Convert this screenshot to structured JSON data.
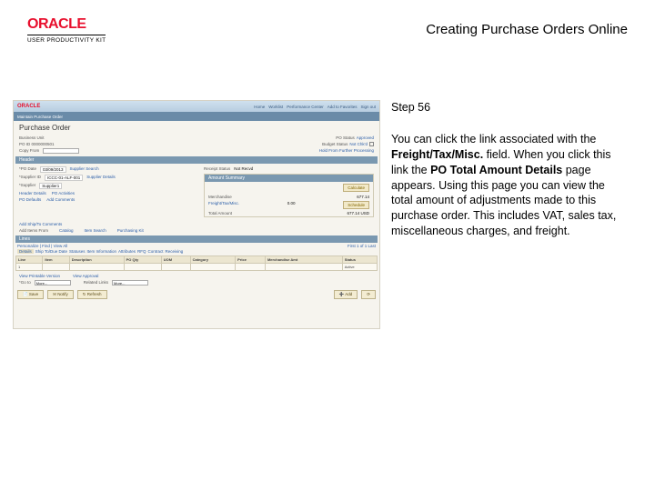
{
  "header": {
    "brand": "ORACLE",
    "brand_sub": "USER PRODUCTIVITY KIT",
    "title": "Creating Purchase Orders Online"
  },
  "step": {
    "label": "Step 56",
    "text_parts": {
      "p1": "You can click the link associated with the ",
      "bold1": "Freight/Tax/Misc.",
      "p2": " field. When you click this link the ",
      "bold2": "PO Total Amount Details",
      "p3": " page appears. Using this page you can view the total amount of adjustments made to this purchase order. This includes VAT, sales tax, miscellaneous charges, and freight."
    }
  },
  "screenshot": {
    "oracle_small": "ORACLE",
    "nav": [
      "Home",
      "Worklist",
      "Performance Center",
      "Add to Favorites",
      "Sign out"
    ],
    "darkbar_text": "Maintain Purchase Order",
    "page_title": "Purchase Order",
    "sub1": "Business Unit",
    "sub2": "PO ID  0000000501",
    "row1": {
      "po_status_label": "PO Status",
      "po_status_val": "Approved",
      "budget_label": "Budget Status",
      "budget_val": "Not Chk'd"
    },
    "copy_from_label": "Copy From",
    "hold_link": "Hold From Further Processing",
    "po_date_label": "*PO Date",
    "po_date_val": "03/09/2013",
    "supplier_label": "Supplier Search",
    "supplier_id_label": "*Supplier ID",
    "supplier_id_val": "ICCC-01-ALF-001",
    "id_alt_label": "Supplier Details",
    "supplier_name_label": "*Supplier",
    "supplier_name_val": "Supplier1",
    "calc_btn": "Calculate",
    "receipt_label": "Receipt Status",
    "receipt_val": "Not Recvd",
    "header_details_label": "Header Details",
    "po_defaults_label": "PO Defaults",
    "po_activities_label": "PO Activities",
    "add_comments_label": "Add Comments",
    "amount_summary_hdr": "Amount Summary",
    "merch_label": "Merchandise",
    "merch_val": "677.14",
    "ftm_label": "Freight/Tax/Misc.",
    "ftm_val": "0.00",
    "total_label": "Total Amount",
    "total_val": "677.14  USD",
    "schedule_btn": "Schedule",
    "add_ship_label": "Add Ship/To Comments",
    "add_items_label": "Add Items From",
    "catalog_label": "Catalog",
    "item_search_label": "Purchasing Kit",
    "item_search_label2": "Item Search",
    "tabs": [
      "Details",
      "Ship To/Due Date",
      "Statuses",
      "Item Information",
      "Attributes",
      "RFQ",
      "Contract",
      "Receiving"
    ],
    "personalize_label": "Personalize | Find | View All",
    "first_last": "First 1 of 1 Last",
    "grid": {
      "headers": [
        "Line",
        "Item",
        "Description",
        "PO Qty",
        "UOM",
        "Category",
        "Price",
        "Merchandise Amt",
        "Status"
      ],
      "row": [
        "1",
        "",
        "",
        "",
        "",
        "",
        "",
        "",
        "Active"
      ]
    },
    "row2": {
      "view_printable": "View Printable Version",
      "approval": "View Approval"
    },
    "go_row": {
      "go_to_label": "*Go to",
      "more_label": "More...",
      "related_label": "Related Links",
      "more2": "More..."
    },
    "footer_btns": {
      "save": "Save",
      "notify": "Notify",
      "refresh": "Refresh",
      "add": "Add",
      "next": ""
    }
  }
}
